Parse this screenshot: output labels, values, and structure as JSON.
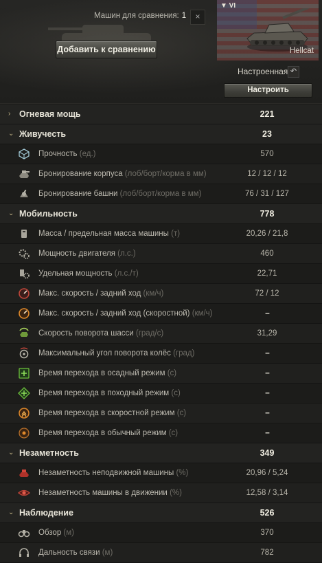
{
  "header": {
    "compare_label": "Машин для сравнения:",
    "compare_count": "1",
    "close_glyph": "×",
    "add_button": "Добавить к сравнению",
    "tank": {
      "tier": "▼ VI",
      "name": "Hellcat",
      "nation_flag": "usa-flag"
    },
    "config_label": "Настроенная",
    "reset_glyph": "↶",
    "configure_button": "Настроить"
  },
  "colors": {
    "accent_chevron": "#c9b98a",
    "background": "#1b1b19",
    "category_row": "#232321"
  },
  "stats": {
    "firepower": {
      "label": "Огневая мощь",
      "value": "221"
    },
    "survivability": {
      "label": "Живучесть",
      "value": "23",
      "items": [
        {
          "label": "Прочность",
          "unit": "(ед.)",
          "value": "570",
          "icon": "durability-icon"
        },
        {
          "label": "Бронирование корпуса",
          "unit": "(лоб/борт/корма в мм)",
          "value": "12 / 12 / 12",
          "icon": "hull-armor-icon"
        },
        {
          "label": "Бронирование башни",
          "unit": "(лоб/борт/корма в мм)",
          "value": "76 / 31 / 127",
          "icon": "turret-armor-icon"
        }
      ]
    },
    "mobility": {
      "label": "Мобильность",
      "value": "778",
      "items": [
        {
          "label": "Масса / предельная масса машины",
          "unit": "(т)",
          "value": "20,26 / 21,8",
          "icon": "weight-icon"
        },
        {
          "label": "Мощность двигателя",
          "unit": "(л.с.)",
          "value": "460",
          "icon": "engine-icon"
        },
        {
          "label": "Удельная мощность",
          "unit": "(л.с./т)",
          "value": "22,71",
          "icon": "power-ratio-icon"
        },
        {
          "label": "Макс. скорость / задний ход",
          "unit": "(км/ч)",
          "value": "72 / 12",
          "icon": "speedometer-icon"
        },
        {
          "label": "Макс. скорость / задний ход (скоростной)",
          "unit": "(км/ч)",
          "value": "--",
          "icon": "speedometer-fast-icon"
        },
        {
          "label": "Скорость поворота шасси",
          "unit": "(град/с)",
          "value": "31,29",
          "icon": "traverse-icon"
        },
        {
          "label": "Максимальный угол поворота колёс",
          "unit": "(град)",
          "value": "--",
          "icon": "wheel-angle-icon"
        },
        {
          "label": "Время перехода в осадный режим",
          "unit": "(с)",
          "value": "--",
          "icon": "siege-mode-icon"
        },
        {
          "label": "Время перехода в походный режим",
          "unit": "(с)",
          "value": "--",
          "icon": "travel-mode-icon"
        },
        {
          "label": "Время перехода в скоростной режим",
          "unit": "(с)",
          "value": "--",
          "icon": "speed-mode-icon"
        },
        {
          "label": "Время перехода в обычный режим",
          "unit": "(с)",
          "value": "--",
          "icon": "normal-mode-icon"
        }
      ]
    },
    "concealment": {
      "label": "Незаметность",
      "value": "349",
      "items": [
        {
          "label": "Незаметность неподвижной машины",
          "unit": "(%)",
          "value": "20,96 / 5,24",
          "icon": "camo-stationary-icon"
        },
        {
          "label": "Незаметность машины в движении",
          "unit": "(%)",
          "value": "12,58 / 3,14",
          "icon": "camo-moving-icon"
        }
      ]
    },
    "spotting": {
      "label": "Наблюдение",
      "value": "526",
      "items": [
        {
          "label": "Обзор",
          "unit": "(м)",
          "value": "370",
          "icon": "binoculars-icon"
        },
        {
          "label": "Дальность связи",
          "unit": "(м)",
          "value": "782",
          "icon": "radio-headset-icon"
        }
      ]
    }
  }
}
